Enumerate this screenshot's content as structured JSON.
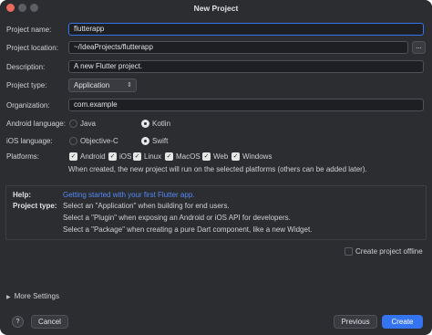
{
  "window": {
    "title": "New Project"
  },
  "form": {
    "project_name": {
      "label": "Project name:",
      "value": "flutterapp"
    },
    "project_location": {
      "label": "Project location:",
      "value": "~/IdeaProjects/flutterapp",
      "browse_label": "..."
    },
    "description": {
      "label": "Description:",
      "value": "A new Flutter project."
    },
    "project_type": {
      "label": "Project type:",
      "selected": "Application"
    },
    "organization": {
      "label": "Organization:",
      "value": "com.example"
    },
    "android_language": {
      "label": "Android language:",
      "options": [
        "Java",
        "Kotlin"
      ],
      "selected": "Kotlin"
    },
    "ios_language": {
      "label": "iOS language:",
      "options": [
        "Objective-C",
        "Swift"
      ],
      "selected": "Swift"
    },
    "platforms": {
      "label": "Platforms:",
      "items": [
        {
          "label": "Android",
          "checked": true
        },
        {
          "label": "iOS",
          "checked": true
        },
        {
          "label": "Linux",
          "checked": true
        },
        {
          "label": "MacOS",
          "checked": true
        },
        {
          "label": "Web",
          "checked": true
        },
        {
          "label": "Windows",
          "checked": true
        }
      ],
      "note": "When created, the new project will run on the selected platforms (others can be added later)."
    }
  },
  "help": {
    "help_label": "Help:",
    "help_link": "Getting started with your first Flutter app.",
    "type_label": "Project type:",
    "lines": [
      "Select an \"Application\" when building for end users.",
      "Select a \"Plugin\" when exposing an Android or iOS API for developers.",
      "Select a \"Package\" when creating a pure Dart component, like a new Widget."
    ]
  },
  "offline": {
    "label": "Create project offline",
    "checked": false
  },
  "more_settings": {
    "label": "More Settings"
  },
  "buttons": {
    "help": "?",
    "cancel": "Cancel",
    "previous": "Previous",
    "create": "Create"
  },
  "colors": {
    "background": "#2b2d30",
    "accent": "#3574f0",
    "link": "#548af7"
  },
  "icons": {
    "dropdown": "chevron-updown-icon",
    "more_settings": "triangle-right-icon"
  }
}
